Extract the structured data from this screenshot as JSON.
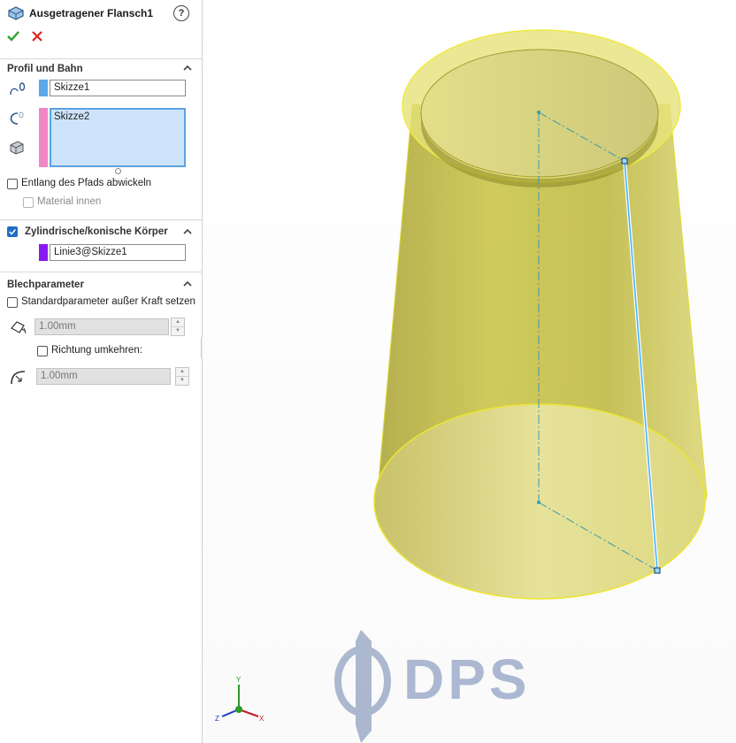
{
  "feature": {
    "title": "Ausgetragener Flansch1",
    "help_symbol": "?"
  },
  "profile_section": {
    "label": "Profil und Bahn",
    "sketch1": "Skizze1",
    "sketch2": "Skizze2",
    "sketch1_color": "#5aa7ea",
    "sketch2_color": "#f187c6",
    "unfold_along_path_label": "Entlang des Pfads abwickeln",
    "unfold_along_path_checked": false,
    "material_inside_label": "Material innen",
    "material_inside_checked": false
  },
  "cylindrical_section": {
    "label": "Zylindrische/konische Körper",
    "checked": true,
    "edge": "Linie3@Skizze1",
    "edge_color": "#8a18f0"
  },
  "sheet_params_section": {
    "label": "Blechparameter",
    "override_label": "Standardparameter außer Kraft setzen",
    "override_checked": false,
    "thickness": "1.00mm",
    "reverse_label": "Richtung umkehren:",
    "reverse_checked": false,
    "bend_radius": "1.00mm"
  },
  "triad": {
    "x": "X",
    "y": "Y",
    "z": "Z"
  },
  "watermark": {
    "text": "DPS"
  },
  "colors": {
    "body_fill": "#c8c240",
    "body_edge": "#e6e028",
    "accent": "#1e6fc7",
    "selected_line": "#4ab2ff"
  }
}
